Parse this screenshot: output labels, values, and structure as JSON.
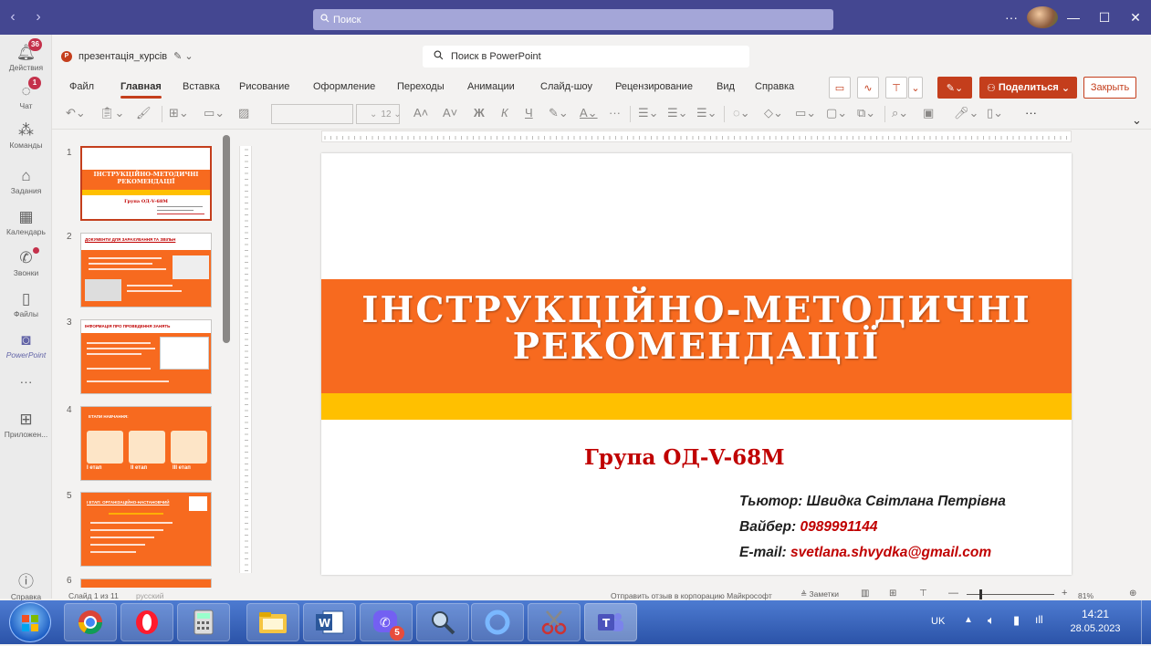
{
  "titlebar": {
    "search_placeholder": "Поиск",
    "more": "···",
    "minimize": "—",
    "maximize": "☐",
    "close": "✕"
  },
  "rail": {
    "items": [
      {
        "label": "Действия",
        "badge": "36"
      },
      {
        "label": "Чат",
        "badge": "1"
      },
      {
        "label": "Команды"
      },
      {
        "label": "Задания"
      },
      {
        "label": "Календарь"
      },
      {
        "label": "Звонки"
      },
      {
        "label": "Файлы"
      },
      {
        "label": "PowerPoint"
      },
      {
        "label": "···"
      },
      {
        "label": "Приложен..."
      },
      {
        "label": "Справка"
      }
    ]
  },
  "appheader": {
    "doc_name": "презентація_курсів",
    "search_placeholder": "Поиск в PowerPoint"
  },
  "ribbon": {
    "tabs": [
      "Файл",
      "Главная",
      "Вставка",
      "Рисование",
      "Оформление",
      "Переходы",
      "Анимации",
      "Слайд-шоу",
      "Рецензирование",
      "Вид",
      "Справка"
    ],
    "active_tab": "Главная",
    "share_label": "Поделиться",
    "close_label": "Закрыть",
    "font_size": "12"
  },
  "thumbnails": [
    {
      "num": "1",
      "title": "ІНСТРУКЦІЙНО-МЕТОДИЧНІ РЕКОМЕНДАЦІЇ",
      "subtitle": "Група ОД-V-68М"
    },
    {
      "num": "2",
      "title": "ДОКУМЕНТИ ДЛЯ ЗАРАХУВАННЯ ТА ЗВІЛЬН"
    },
    {
      "num": "3",
      "title": "ІНФОРМАЦІЯ ПРО ПРОВЕДЕННЯ ЗАНЯТЬ"
    },
    {
      "num": "4",
      "title": "ЕТАПИ НАВЧАННЯ:",
      "stages": [
        "І етап",
        "ІІ етап",
        "ІІІ етап"
      ]
    },
    {
      "num": "5",
      "title": "І ЕТАП: ОРГАНІЗАЦІЙНО-НАСТАНОВЧИЙ"
    },
    {
      "num": "6"
    }
  ],
  "slide": {
    "title_line1": "ІНСТРУКЦІЙНО-МЕТОДИЧНІ",
    "title_line2": "РЕКОМЕНДАЦІЇ",
    "group": "Група  ОД-V-68М",
    "tutor_label": "Тьютор:",
    "tutor_value": "Швидка Світлана Петрівна",
    "viber_label": "Вайбер:",
    "viber_value": "0989991144",
    "email_label": "E-mail:",
    "email_value": "svetlana.shvydka@gmail.com"
  },
  "statusbar": {
    "slide_info": "Слайд 1 из 11",
    "language": "русский",
    "feedback": "Отправить отзыв в корпорацию Майкрософт",
    "notes": "Заметки",
    "zoom": "81%"
  },
  "taskbar": {
    "viber_badge": "5",
    "lang": "UK",
    "time": "14:21",
    "date": "28.05.2023"
  },
  "colors": {
    "teams_purple": "#444791",
    "ppt_accent": "#c43e1c",
    "slide_orange": "#f76a1f",
    "slide_yellow": "#ffc000",
    "slide_red": "#c00000"
  }
}
